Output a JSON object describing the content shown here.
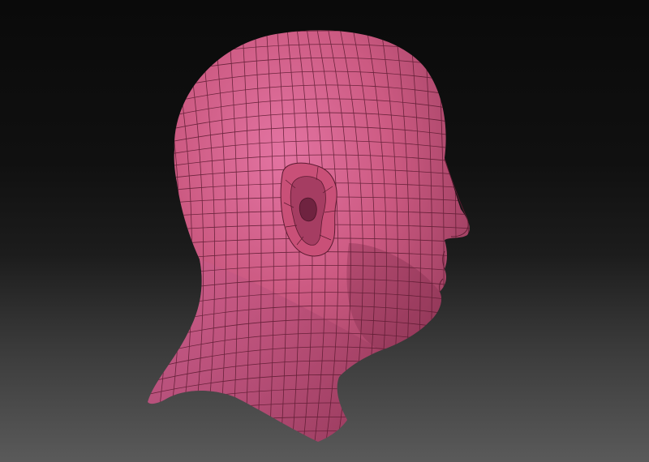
{
  "scene": {
    "subject": "sculpt-head-mesh",
    "mesh_color": "#c9557a",
    "mesh_highlight_color": "#e06a9a",
    "mesh_shadow_color": "#8f3656",
    "wireframe_color": "#5a1a30",
    "background_top_color": "#0a0a0a",
    "background_bottom_color": "#5a5a5a"
  }
}
